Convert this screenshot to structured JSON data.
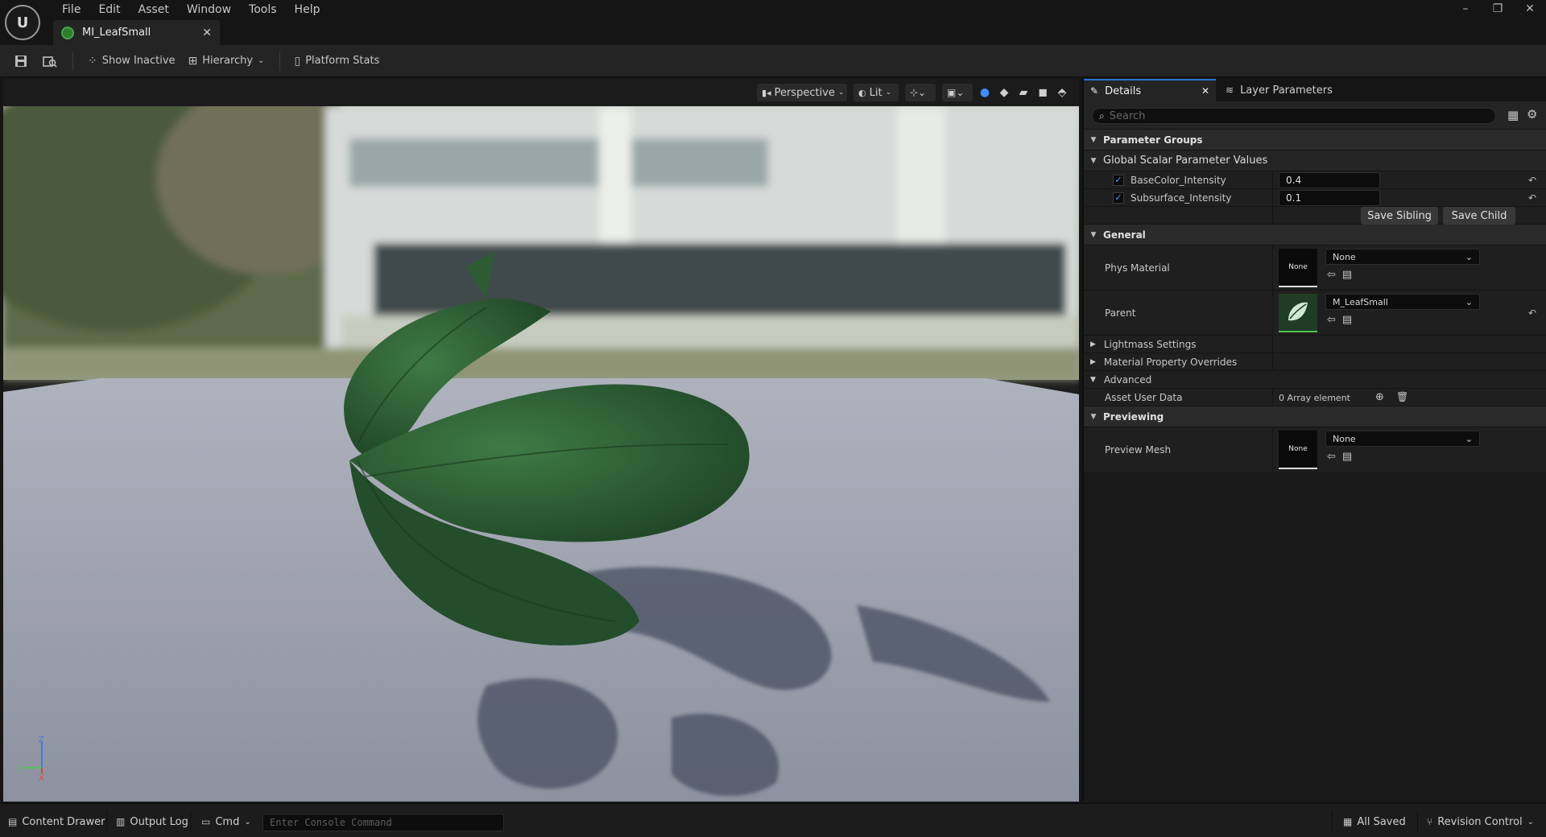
{
  "menu": [
    "File",
    "Edit",
    "Asset",
    "Window",
    "Tools",
    "Help"
  ],
  "document_tab": {
    "label": "MI_LeafSmall"
  },
  "toolbar": {
    "show_inactive": "Show Inactive",
    "hierarchy": "Hierarchy",
    "platform_stats": "Platform Stats"
  },
  "viewport": {
    "view_mode": "Perspective",
    "lighting": "Lit"
  },
  "details": {
    "tab_details": "Details",
    "tab_layer_parameters": "Layer Parameters",
    "search_placeholder": "Search",
    "parameter_groups": "Parameter Groups",
    "global_scalar": "Global Scalar Parameter Values",
    "params": [
      {
        "name": "BaseColor_Intensity",
        "value": "0.4",
        "checked": true
      },
      {
        "name": "Subsurface_Intensity",
        "value": "0.1",
        "checked": true
      }
    ],
    "save_sibling": "Save Sibling",
    "save_child": "Save Child",
    "general": "General",
    "phys_material_label": "Phys Material",
    "phys_material_thumb": "None",
    "phys_material_value": "None",
    "parent_label": "Parent",
    "parent_value": "M_LeafSmall",
    "lightmass": "Lightmass Settings",
    "material_overrides": "Material Property Overrides",
    "advanced": "Advanced",
    "asset_user_data_label": "Asset User Data",
    "asset_user_data_value": "0 Array element",
    "previewing": "Previewing",
    "preview_mesh_label": "Preview Mesh",
    "preview_mesh_thumb": "None",
    "preview_mesh_value": "None"
  },
  "statusbar": {
    "content_drawer": "Content Drawer",
    "output_log": "Output Log",
    "cmd": "Cmd",
    "console_placeholder": "Enter Console Command",
    "all_saved": "All Saved",
    "revision_control": "Revision Control"
  },
  "colors": {
    "accent_blue": "#2b6fd6",
    "leaf_green": "#2f5a34",
    "floor_gray": "#9da2ae"
  },
  "icons": [
    "unreal-logo-icon",
    "save-icon",
    "browse-icon",
    "show-inactive-icon",
    "hierarchy-icon",
    "platform-stats-icon",
    "search-icon",
    "table-view-icon",
    "settings-icon",
    "reset-arrow-icon",
    "use-selected-icon",
    "browse-folder-icon",
    "add-icon",
    "trash-icon",
    "chevron-down-icon"
  ]
}
